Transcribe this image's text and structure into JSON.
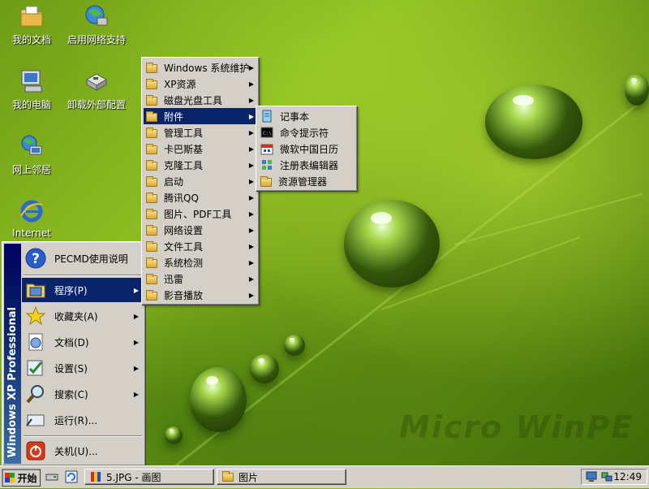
{
  "desktop": {
    "watermark": "Micro WinPE",
    "icons": [
      {
        "label": "我的文档",
        "icon": "my-documents-icon"
      },
      {
        "label": "启用网络支持",
        "icon": "network-support-icon"
      },
      {
        "label": "我的电脑",
        "icon": "my-computer-icon"
      },
      {
        "label": "卸载外部配置",
        "icon": "uninstall-config-icon"
      },
      {
        "label": "网上邻居",
        "icon": "network-places-icon"
      },
      {
        "label": "Internet",
        "icon": "internet-explorer-icon"
      }
    ]
  },
  "start_menu": {
    "side_band": "Windows XP Professional",
    "items": [
      {
        "label": "PECMD使用说明",
        "icon": "help-icon"
      },
      {
        "label": "程序(P)",
        "icon": "programs-icon",
        "submenu": true,
        "active": true
      },
      {
        "label": "收藏夹(A)",
        "icon": "favorites-star-icon",
        "submenu": true
      },
      {
        "label": "文档(D)",
        "icon": "documents-icon",
        "submenu": true
      },
      {
        "label": "设置(S)",
        "icon": "settings-icon",
        "submenu": true
      },
      {
        "label": "搜索(C)",
        "icon": "search-icon",
        "submenu": true
      },
      {
        "label": "运行(R)...",
        "icon": "run-icon"
      },
      {
        "label": "关机(U)...",
        "icon": "shutdown-icon"
      }
    ]
  },
  "programs_menu": {
    "items": [
      {
        "label": "Windows 系统维护"
      },
      {
        "label": "XP资源"
      },
      {
        "label": "磁盘光盘工具"
      },
      {
        "label": "附件",
        "active": true
      },
      {
        "label": "管理工具"
      },
      {
        "label": "卡巴斯基"
      },
      {
        "label": "克隆工具"
      },
      {
        "label": "启动"
      },
      {
        "label": "腾讯QQ"
      },
      {
        "label": "图片、PDF工具"
      },
      {
        "label": "网络设置"
      },
      {
        "label": "文件工具"
      },
      {
        "label": "系统检测"
      },
      {
        "label": "迅雷"
      },
      {
        "label": "影音播放"
      }
    ]
  },
  "accessories_menu": {
    "items": [
      {
        "label": "记事本",
        "icon": "notepad-icon"
      },
      {
        "label": "命令提示符",
        "icon": "command-prompt-icon"
      },
      {
        "label": "微软中国日历",
        "icon": "calendar-icon"
      },
      {
        "label": "注册表编辑器",
        "icon": "registry-editor-icon"
      },
      {
        "label": "资源管理器",
        "icon": "explorer-folder-icon"
      }
    ]
  },
  "taskbar": {
    "start_label": "开始",
    "buttons": [
      {
        "label": "5.JPG - 画图",
        "icon": "paint-icon"
      },
      {
        "label": "图片",
        "icon": "folder-icon"
      }
    ],
    "clock": "12:49",
    "cmd_glyph": "C:\\"
  }
}
